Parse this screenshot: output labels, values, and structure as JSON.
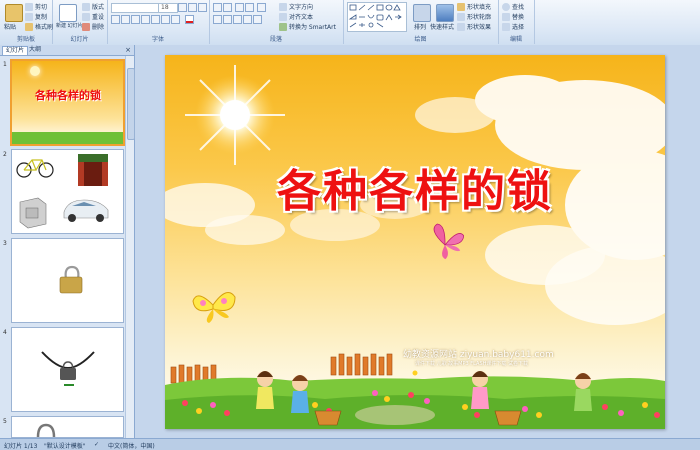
{
  "ribbon": {
    "groups": {
      "clipboard": "剪贴板",
      "slides": "幻灯片",
      "font": "字体",
      "paragraph": "段落",
      "drawing": "绘图",
      "editing": "编辑"
    },
    "paste": "粘贴",
    "cut": "剪切",
    "copy": "复制",
    "format_painter": "格式刷",
    "new_slide": "新建\n幻灯片",
    "layout": "版式",
    "reset": "重设",
    "delete": "删除",
    "font_size": "18",
    "text_direction": "文字方向",
    "align_text": "对齐文本",
    "convert_smartart": "转换为 SmartArt",
    "arrange": "排列",
    "quick_styles": "快速样式",
    "shape_fill": "形状填充",
    "shape_outline": "形状轮廓",
    "shape_effects": "形状效果",
    "find": "查找",
    "replace": "替换",
    "select": "选择"
  },
  "pane": {
    "tab_slides": "幻灯片",
    "tab_outline": "大纲",
    "slide_numbers": [
      "1",
      "2",
      "3",
      "4",
      "5"
    ]
  },
  "slide": {
    "title": "各种各样的锁",
    "watermark_line1": "幼教资源网站  ziyuan.baby611.com",
    "watermark_line2": "课件下载  儿歌  故事MP3  FLASH课件下载  试卷下载"
  },
  "thumb1": {
    "title": "各种各样的锁"
  },
  "status": {
    "slide_counter": "幻灯片 1/13",
    "theme": "\"默认设计模板\"",
    "language": "中文(简体，中国)"
  },
  "colors": {
    "title_red": "#ee1111",
    "ribbon_bg": "#dbe7f5",
    "selection_border": "#f0a030"
  }
}
